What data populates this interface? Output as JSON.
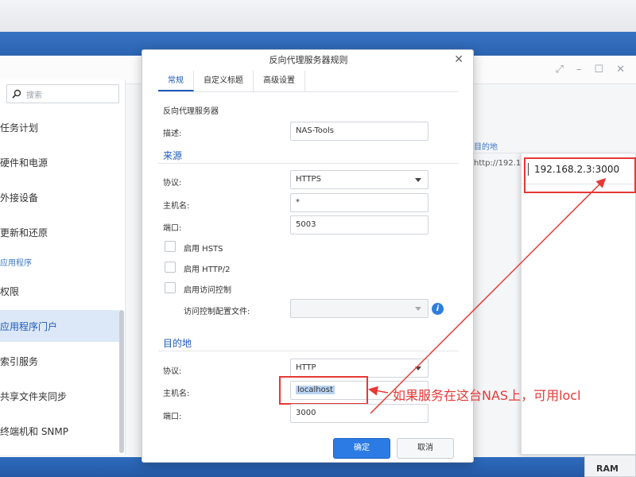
{
  "sidebar": {
    "search_placeholder": "搜索",
    "items": [
      {
        "label": "任务计划"
      },
      {
        "label": "硬件和电源"
      },
      {
        "label": "外接设备"
      },
      {
        "label": "更新和还原"
      },
      {
        "label": "权限"
      },
      {
        "label": "应用程序门户"
      },
      {
        "label": "索引服务"
      },
      {
        "label": "共享文件夹同步"
      },
      {
        "label": "终端机和 SNMP"
      }
    ],
    "section_label": "应用程序"
  },
  "background": {
    "peek_header": "目的地",
    "peek_cell": "http://192.1",
    "ram_label": "RAM"
  },
  "right_popup": {
    "value_prefix": "192.168.2.3:",
    "value_port": "3000"
  },
  "dialog": {
    "title": "反向代理服务器规则",
    "close_icon": "close-icon",
    "tabs": [
      {
        "label": "常规",
        "active": true
      },
      {
        "label": "自定义标题",
        "active": false
      },
      {
        "label": "高级设置",
        "active": false
      }
    ],
    "group_title": "反向代理服务器",
    "description_label": "描述:",
    "description_value": "NAS-Tools",
    "source": {
      "heading": "来源",
      "protocol_label": "协议:",
      "protocol_value": "HTTPS",
      "hostname_label": "主机名:",
      "hostname_value": "*",
      "port_label": "端口:",
      "port_value": "5003",
      "hsts_label": "启用 HSTS",
      "http2_label": "启用 HTTP/2",
      "access_control_label": "启用访问控制",
      "access_profile_label": "访问控制配置文件:",
      "access_profile_value": ""
    },
    "destination": {
      "heading": "目的地",
      "protocol_label": "协议:",
      "protocol_value": "HTTP",
      "hostname_label": "主机名:",
      "hostname_value": "localhost",
      "port_label": "端口:",
      "port_value": "3000"
    },
    "ok_label": "确定",
    "cancel_label": "取消"
  },
  "annotation": {
    "text": "如果服务在这台NAS上，可用locl",
    "color": "#e53935"
  },
  "colors": {
    "accent": "#2c7be5",
    "annotation_red": "#e53935",
    "active_tab": "#1e5bb8"
  }
}
